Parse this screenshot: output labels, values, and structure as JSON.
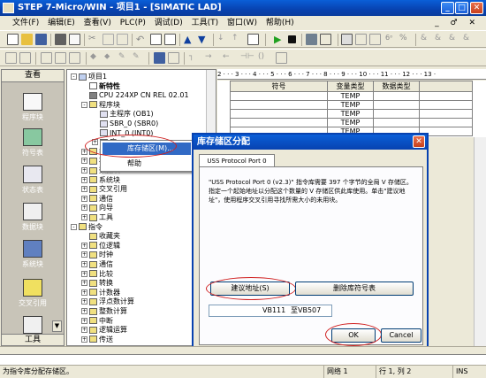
{
  "window": {
    "title": "STEP 7-Micro/WIN - 项目1 - [SIMATIC LAD]",
    "min": "_",
    "max": "□",
    "close": "✕"
  },
  "menu": [
    "文件(F)",
    "编辑(E)",
    "查看(V)",
    "PLC(P)",
    "调试(D)",
    "工具(T)",
    "窗口(W)",
    "帮助(H)"
  ],
  "mdi_controls": "_ ♂ ✕",
  "nav": {
    "header": "查看",
    "items": [
      "程序块",
      "符号表",
      "状态表",
      "数据块",
      "系统块",
      "交叉引用"
    ],
    "footer": "工具"
  },
  "tree": {
    "rows": [
      {
        "label": "项目1",
        "icon": "project-icon",
        "indent": 0,
        "pm": "-"
      },
      {
        "label": "新特性",
        "icon": "help-icon",
        "indent": 1,
        "pm": "",
        "bold": true
      },
      {
        "label": "CPU 224XP CN REL 02.01",
        "icon": "cpu-icon",
        "indent": 1,
        "pm": ""
      },
      {
        "label": "程序块",
        "icon": "folder-icon",
        "indent": 1,
        "pm": "-"
      },
      {
        "label": "主程序 (OB1)",
        "icon": "block-icon",
        "indent": 2,
        "pm": ""
      },
      {
        "label": "SBR_0 (SBR0)",
        "icon": "block-icon",
        "indent": 2,
        "pm": ""
      },
      {
        "label": "INT_0 (INT0)",
        "icon": "block-icon",
        "indent": 2,
        "pm": ""
      },
      {
        "label": "库",
        "icon": "library-icon",
        "indent": 2,
        "pm": "+"
      },
      {
        "label": "符号表",
        "icon": "folder-icon",
        "indent": 1,
        "pm": "+"
      },
      {
        "label": "状态表",
        "icon": "folder-icon",
        "indent": 1,
        "pm": "+"
      },
      {
        "label": "数据块",
        "icon": "folder-icon",
        "indent": 1,
        "pm": "+"
      },
      {
        "label": "系统块",
        "icon": "folder-icon",
        "indent": 1,
        "pm": "+"
      },
      {
        "label": "交叉引用",
        "icon": "folder-icon",
        "indent": 1,
        "pm": "+"
      },
      {
        "label": "通信",
        "icon": "folder-icon",
        "indent": 1,
        "pm": "+"
      },
      {
        "label": "向导",
        "icon": "folder-icon",
        "indent": 1,
        "pm": "+"
      },
      {
        "label": "工具",
        "icon": "folder-icon",
        "indent": 1,
        "pm": "+"
      },
      {
        "label": "指令",
        "icon": "folder-icon",
        "indent": 0,
        "pm": "-"
      },
      {
        "label": "收藏夹",
        "icon": "folder-icon",
        "indent": 1,
        "pm": ""
      },
      {
        "label": "位逻辑",
        "icon": "folder-icon",
        "indent": 1,
        "pm": "+"
      },
      {
        "label": "时钟",
        "icon": "folder-icon",
        "indent": 1,
        "pm": "+"
      },
      {
        "label": "通信",
        "icon": "folder-icon",
        "indent": 1,
        "pm": "+"
      },
      {
        "label": "比较",
        "icon": "folder-icon",
        "indent": 1,
        "pm": "+"
      },
      {
        "label": "转换",
        "icon": "folder-icon",
        "indent": 1,
        "pm": "+"
      },
      {
        "label": "计数器",
        "icon": "folder-icon",
        "indent": 1,
        "pm": "+"
      },
      {
        "label": "浮点数计算",
        "icon": "folder-icon",
        "indent": 1,
        "pm": "+"
      },
      {
        "label": "整数计算",
        "icon": "folder-icon",
        "indent": 1,
        "pm": "+"
      },
      {
        "label": "中断",
        "icon": "folder-icon",
        "indent": 1,
        "pm": "+"
      },
      {
        "label": "逻辑运算",
        "icon": "folder-icon",
        "indent": 1,
        "pm": "+"
      },
      {
        "label": "传送",
        "icon": "folder-icon",
        "indent": 1,
        "pm": "+"
      }
    ]
  },
  "ruler": "2 · · · 3 · · · 4 · · · 5 · · · 6 · · · 7 · · · 8 · · · 9 · · · 10 · · · 11 · · · 12 · · · 13 ·",
  "var_table": {
    "headers": [
      "符号",
      "变量类型",
      "数据类型"
    ],
    "rows": [
      [
        "",
        "TEMP",
        ""
      ],
      [
        "",
        "TEMP",
        ""
      ],
      [
        "",
        "TEMP",
        ""
      ],
      [
        "",
        "TEMP",
        ""
      ],
      [
        "",
        "TEMP",
        ""
      ]
    ]
  },
  "context_menu": {
    "items": [
      "库存储区(M)...",
      "帮助"
    ]
  },
  "dialog": {
    "title": "库存储区分配",
    "tab": "USS Protocol Port 0 (v2.3)",
    "message": "\"USS Protocol Port 0 (v2.3)\" 指令库需要 397 个字节的全局 V 存储区。指定一个起始地址以分配这个数量的 V 存储区供此库使用。单击\"建议地址\"，使用程序交叉引用寻找所需大小的未用块。",
    "suggest_btn": "建议地址(S)",
    "delete_btn": "删除库符号表",
    "address_value": "VB111",
    "address_end": "至VB507",
    "ok": "OK",
    "cancel": "Cancel"
  },
  "status": {
    "hint": "为指令库分配存储区。",
    "network": "网络 1",
    "rowcol": "行 1, 列 2",
    "mode": "INS"
  },
  "colors": {
    "titlebar": "#0842b0",
    "highlight": "#d02020",
    "selection": "#316ac5"
  }
}
